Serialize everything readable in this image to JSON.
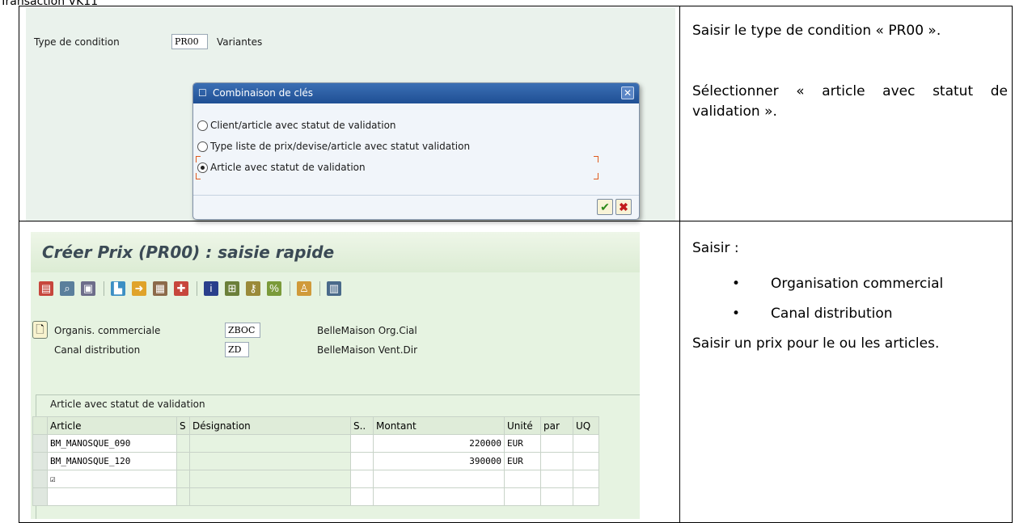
{
  "caption": "Transaction VK11",
  "top_notes": {
    "p1": "Saisir le type de condition « PR00 ».",
    "p2": "Sélectionner « article avec statut de validation »."
  },
  "bottom_notes": {
    "intro": "Saisir :",
    "bullets": [
      "Organisation commercial",
      "Canal distribution"
    ],
    "outro": "Saisir un prix pour le ou les articles."
  },
  "sap_top": {
    "field_label": "Type de condition",
    "field_value": "PR00",
    "variants_label": "Variantes",
    "dialog": {
      "title": "Combinaison de clés",
      "options": [
        {
          "label": "Client/article avec statut de validation",
          "checked": false
        },
        {
          "label": "Type liste de prix/devise/article avec statut validation",
          "checked": false
        },
        {
          "label": "Article avec statut de validation",
          "checked": true
        }
      ]
    }
  },
  "sap_bottom": {
    "title": "Créer Prix (PR00) : saisie rapide",
    "org_label": "Organis. commerciale",
    "org_value": "ZBOC",
    "org_desc": "BelleMaison Org.Cial",
    "canal_label": "Canal distribution",
    "canal_value": "ZD",
    "canal_desc": "BelleMaison Vent.Dir",
    "section_title": "Article avec statut de validation",
    "columns": [
      "Article",
      "S",
      "Désignation",
      "S..",
      "Montant",
      "Unité",
      "par",
      "UQ"
    ],
    "rows": [
      {
        "article": "BM_MANOSQUE_090",
        "montant": "220000",
        "unite": "EUR"
      },
      {
        "article": "BM_MANOSQUE_120",
        "montant": "390000",
        "unite": "EUR"
      },
      {
        "article": "☑",
        "montant": "",
        "unite": ""
      }
    ]
  }
}
